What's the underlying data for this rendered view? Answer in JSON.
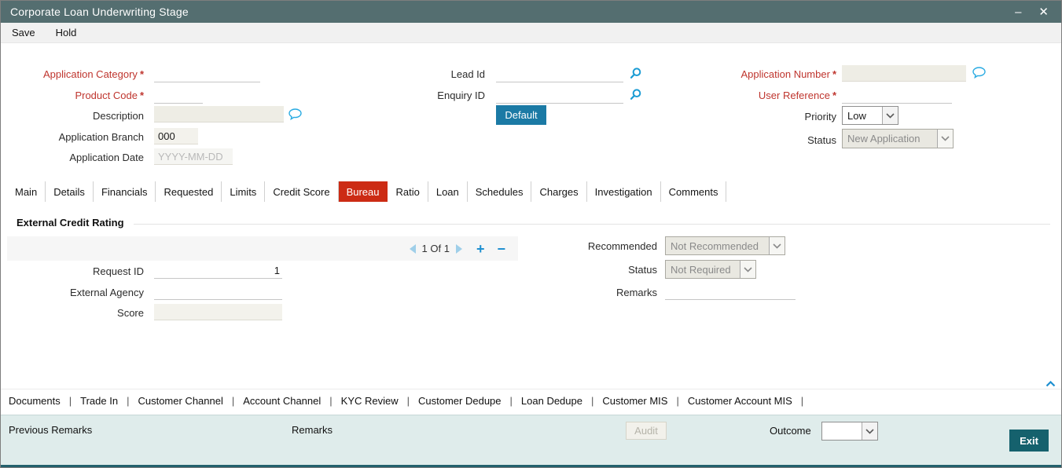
{
  "window": {
    "title": "Corporate Loan Underwriting Stage",
    "minimize_glyph": "–",
    "close_glyph": "✕"
  },
  "menubar": {
    "items": [
      "Save",
      "Hold"
    ]
  },
  "required_marker": "*",
  "header_form": {
    "application_category_label": "Application Category",
    "product_code_label": "Product Code",
    "description_label": "Description",
    "application_branch_label": "Application Branch",
    "application_branch_value": "000",
    "application_date_label": "Application Date",
    "application_date_placeholder": "YYYY-MM-DD",
    "lead_id_label": "Lead Id",
    "enquiry_id_label": "Enquiry ID",
    "default_button_label": "Default",
    "application_number_label": "Application Number",
    "user_reference_label": "User Reference",
    "priority_label": "Priority",
    "priority_value": "Low",
    "status_label": "Status",
    "status_value": "New Application"
  },
  "tabs": {
    "active": "Bureau",
    "items": [
      "Main",
      "Details",
      "Financials",
      "Requested",
      "Limits",
      "Credit Score",
      "Bureau",
      "Ratio",
      "Loan",
      "Schedules",
      "Charges",
      "Investigation",
      "Comments"
    ]
  },
  "bureau_section": {
    "title": "External Credit Rating",
    "pager_text": "1 Of 1",
    "add_glyph": "+",
    "remove_glyph": "−",
    "request_id_label": "Request ID",
    "request_id_value": "1",
    "external_agency_label": "External Agency",
    "score_label": "Score",
    "recommended_label": "Recommended",
    "recommended_value": "Not Recommended",
    "status_label": "Status",
    "status_value": "Not Required",
    "remarks_label": "Remarks"
  },
  "footer_links": {
    "separator": "|",
    "items": [
      "Documents",
      "Trade In",
      "Customer Channel",
      "Account Channel",
      "KYC Review",
      "Customer Dedupe",
      "Loan Dedupe",
      "Customer MIS",
      "Customer Account MIS"
    ]
  },
  "statusbar": {
    "previous_remarks_label": "Previous Remarks",
    "remarks_label": "Remarks",
    "audit_button_label": "Audit",
    "outcome_label": "Outcome",
    "exit_button_label": "Exit"
  },
  "colors": {
    "titlebar": "#546e70",
    "active_tab": "#cc2b14",
    "accent_blue": "#1b7aa5",
    "exit_button": "#15616d",
    "required_label": "#bf352e",
    "icon_blue": "#29abe2"
  }
}
